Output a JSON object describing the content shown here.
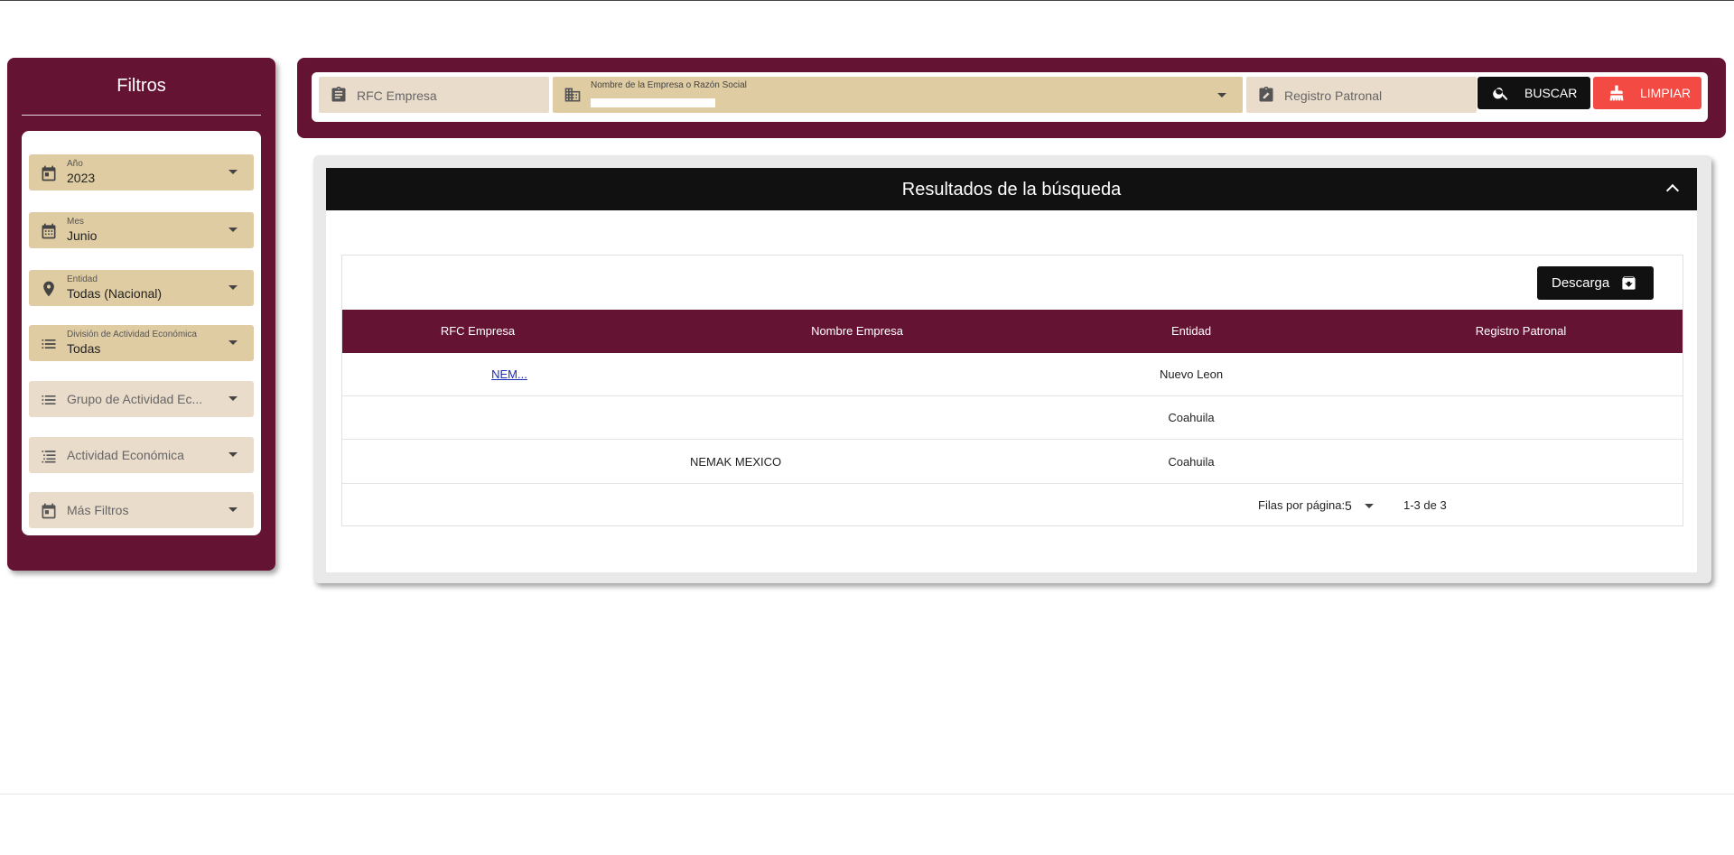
{
  "sidebar": {
    "title": "Filtros",
    "filters": [
      {
        "label": "Año",
        "value": "2023",
        "icon": "calendar-icon"
      },
      {
        "label": "Mes",
        "value": "Junio",
        "icon": "calendar-grid-icon"
      },
      {
        "label": "Entidad",
        "value": "Todas (Nacional)",
        "icon": "location-pin-icon"
      },
      {
        "label": "División de Actividad Económica",
        "value": "Todas",
        "icon": "list-icon"
      },
      {
        "placeholder": "Grupo de Actividad Ec...",
        "icon": "list-icon"
      },
      {
        "placeholder": "Actividad Económica",
        "icon": "numbered-list-icon"
      },
      {
        "placeholder": "Más Filtros",
        "icon": "calendar-icon"
      }
    ]
  },
  "search": {
    "rfc_placeholder": "RFC Empresa",
    "company_label": "Nombre de la Empresa o Razón Social",
    "registro_placeholder": "Registro Patronal",
    "search_button": "BUSCAR",
    "clear_button": "LIMPIAR"
  },
  "results": {
    "title": "Resultados de la búsqueda",
    "download_button": "Descarga",
    "columns": [
      "RFC Empresa",
      "Nombre Empresa",
      "Entidad",
      "Registro Patronal"
    ],
    "rows": [
      {
        "rfc": "NEM...",
        "name": "",
        "entidad": "Nuevo Leon",
        "registro": ""
      },
      {
        "rfc": "",
        "name": "",
        "entidad": "Coahuila",
        "registro": ""
      },
      {
        "rfc": "",
        "name": "NEMAK MEXICO",
        "entidad": "Coahuila",
        "registro": ""
      }
    ],
    "rows_per_page_label": "Filas por página:",
    "rows_per_page_value": "5",
    "range_text": "1-3 de 3"
  },
  "colors": {
    "primary": "#651332",
    "tan": "#e0cca3",
    "light_tan": "#eadccb",
    "clear_red": "#f34a43",
    "dark": "#111111"
  }
}
